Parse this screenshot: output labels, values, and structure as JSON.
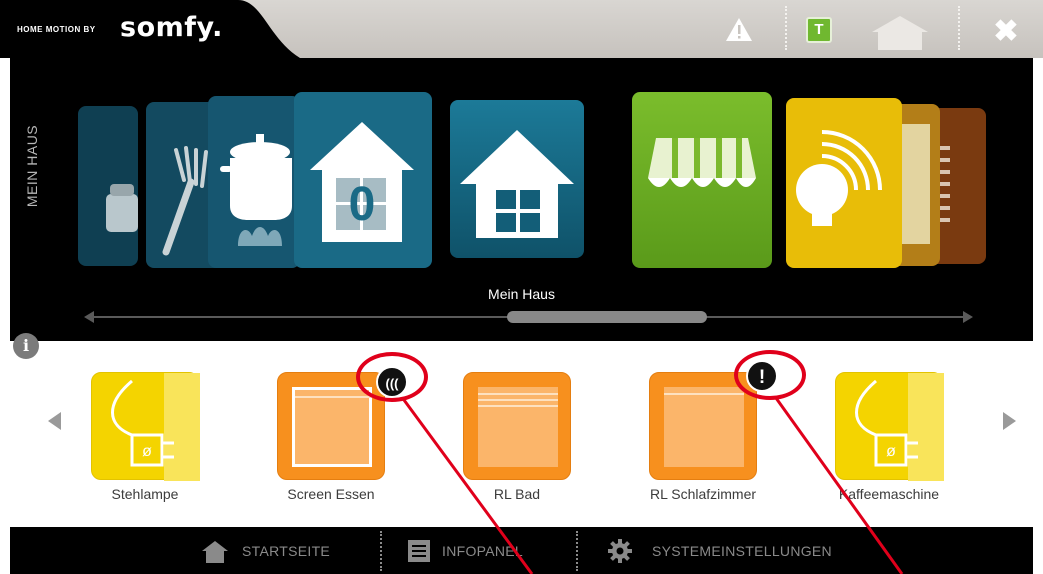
{
  "header": {
    "brand_prefix": "HOME MOTION BY",
    "brand_logo": "somfy.",
    "t_badge": "T",
    "close_glyph": "✖"
  },
  "carousel": {
    "side_title": "MEIN HAUS",
    "selected_label": "Mein Haus",
    "cards": [
      {
        "icon": "oven-icon"
      },
      {
        "icon": "fork-icon"
      },
      {
        "icon": "cooking-pot-icon"
      },
      {
        "icon": "house-zero-icon",
        "text": "0"
      },
      {
        "icon": "house-icon"
      },
      {
        "icon": "awning-icon"
      },
      {
        "icon": "light-bulb-icon"
      },
      {
        "icon": "shutter-icon"
      },
      {
        "icon": "blind-icon"
      }
    ]
  },
  "info_glyph": "i",
  "devices": [
    {
      "label": "Stehlampe",
      "color": "#f4d400",
      "icon": "plug-icon",
      "badge": null
    },
    {
      "label": "Screen Essen",
      "color": "#f7901e",
      "icon": "screen-icon",
      "badge": "signal"
    },
    {
      "label": "RL Bad",
      "color": "#f7901e",
      "icon": "roller-shutter-icon",
      "badge": null
    },
    {
      "label": "RL Schlafzimmer",
      "color": "#f7901e",
      "icon": "roller-shutter-icon",
      "badge": "alert"
    },
    {
      "label": "Kaffeemaschine",
      "color": "#f4d400",
      "icon": "plug-icon",
      "badge": null
    }
  ],
  "badges": {
    "alert": "!",
    "signal": "((("
  },
  "bottom_nav": [
    {
      "label": "STARTSEITE",
      "icon": "home-icon"
    },
    {
      "label": "INFOPANEL",
      "icon": "list-icon"
    },
    {
      "label": "SYSTEMEINSTELLUNGEN",
      "icon": "gear-icon"
    }
  ],
  "colors": {
    "accent_blue": "#1a6a86",
    "accent_green": "#7ab52a",
    "accent_yellow": "#f4d400",
    "accent_orange": "#f7901e",
    "annotation_red": "#e0001b"
  }
}
